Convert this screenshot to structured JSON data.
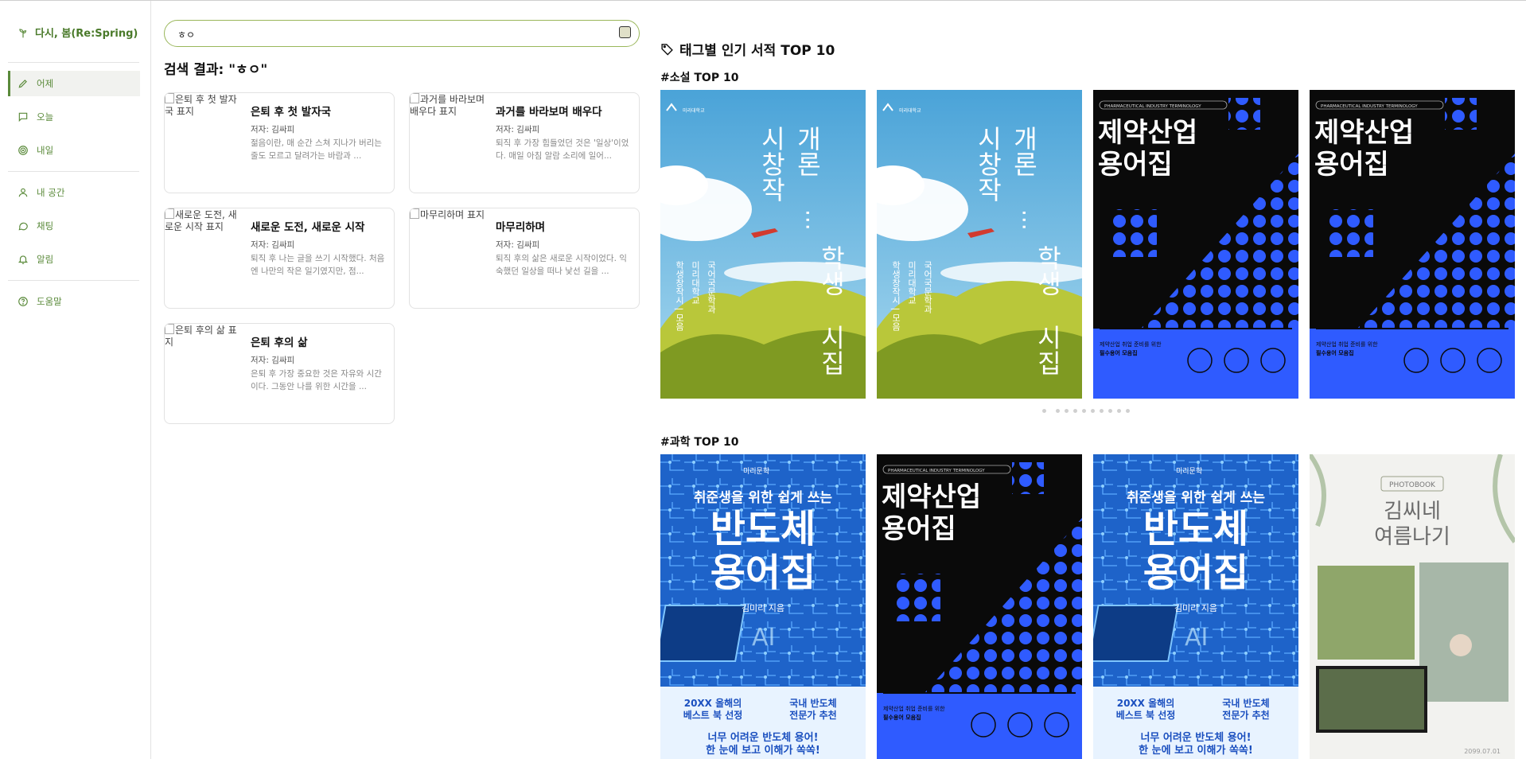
{
  "app": {
    "brand": "다시, 봄(Re:Spring)"
  },
  "sidebar": {
    "items": [
      {
        "label": "어제",
        "icon": "pencil-icon",
        "active": true
      },
      {
        "label": "오늘",
        "icon": "chat-bubble-icon",
        "active": false
      },
      {
        "label": "내일",
        "icon": "target-icon",
        "active": false
      },
      {
        "label": "내 공간",
        "icon": "user-icon",
        "active": false
      },
      {
        "label": "채팅",
        "icon": "message-circle-icon",
        "active": false
      },
      {
        "label": "알림",
        "icon": "bell-icon",
        "active": false
      },
      {
        "label": "도움말",
        "icon": "help-circle-icon",
        "active": false
      }
    ]
  },
  "search": {
    "value": "ㅎㅇ"
  },
  "results": {
    "title": "검색 결과: \"ㅎㅇ\"",
    "items": [
      {
        "title": "은퇴 후 첫 발자국",
        "cover_alt": "은퇴 후 첫 발자국 표지",
        "author": "저자: 김싸피",
        "desc": "젊음이란, 매 순간 스쳐 지나가 버리는 줄도 모르고 달려가는 바람과 ..."
      },
      {
        "title": "과거를 바라보며 배우다",
        "cover_alt": "과거를 바라보며 배우다 표지",
        "author": "저자: 김싸피",
        "desc": "퇴직 후 가장 힘들었던 것은 '일상'이었다. 매일 아침 알람 소리에 일어..."
      },
      {
        "title": "새로운 도전, 새로운 시작",
        "cover_alt": "새로운 도전, 새로운 시작 표지",
        "author": "저자: 김싸피",
        "desc": "퇴직 후 나는 글을 쓰기 시작했다. 처음엔 나만의 작은 일기였지만, 점..."
      },
      {
        "title": "마무리하며",
        "cover_alt": "마무리하며 표지",
        "author": "저자: 김싸피",
        "desc": "퇴직 후의 삶은 새로운 시작이었다. 익숙했던 일상을 떠나 낯선 길을 ..."
      },
      {
        "title": "은퇴 후의 삶",
        "cover_alt": "은퇴 후의 삶 표지",
        "author": "저자: 김싸피",
        "desc": "은퇴 후 가장 중요한 것은 자유와 시간이다. 그동안 나를 위한 시간을 ..."
      }
    ]
  },
  "popular": {
    "heading": "태그별 인기 서적 TOP 10",
    "sections": [
      {
        "label": "#소설 TOP 10"
      },
      {
        "label": "#과학 TOP 10"
      }
    ]
  },
  "covers": {
    "poetry": {
      "publisher": "미리대학교",
      "title_a": "시창작",
      "title_b": "개론",
      "ellipsis": "···",
      "title_c": "학생",
      "title_d": "시집",
      "col1": "국어국문학과",
      "col2": "미리대학교",
      "col3": "학생창작시 | 모음"
    },
    "pharma": {
      "header": "PHARMACEUTICAL INDUSTRY TERMINOLOGY",
      "title1": "제약산업",
      "title2": "용어집",
      "sub1": "제약산업 취업 준비를 위한",
      "sub2": "필수용어 모음집"
    },
    "semi": {
      "publisher": "미리문학",
      "top": "취준생을 위한 쉽게 쓰는",
      "title1": "반도체",
      "title2": "용어집",
      "author": "김미리 지음",
      "badge1a": "20XX 올해의",
      "badge1b": "베스트 북 선정",
      "badge2a": "국내 반도체",
      "badge2b": "전문가 추천",
      "bottom1": "너무 어려운 반도체 용어!",
      "bottom2": "한 눈에 보고 이해가 쏙쏙!",
      "chip": "AI"
    },
    "photo": {
      "tag": "PHOTOBOOK",
      "title1": "김씨네",
      "title2": "여름나기",
      "date": "2099.07.01"
    }
  },
  "carousel": {
    "dot_count": 10
  },
  "colors": {
    "accent": "#5a8a3a",
    "search_border": "#9ab75b",
    "pharma_blue": "#2f5bff"
  }
}
